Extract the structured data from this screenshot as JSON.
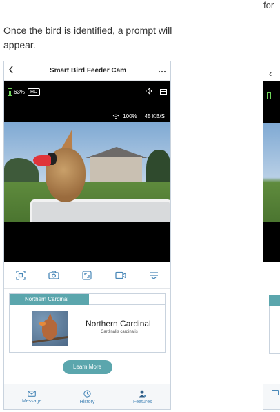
{
  "page": {
    "partial_text_right": "for",
    "instruction": "Once the bird is identified, a prompt will appear."
  },
  "app": {
    "title": "Smart Bird Feeder Cam",
    "back_icon": "chevron-left-icon",
    "more_icon": "more-dots-icon"
  },
  "status": {
    "battery": "63%",
    "quality": "HD",
    "wifi": "100%",
    "speed": "45 KB/S"
  },
  "controls": [
    {
      "name": "scan-icon"
    },
    {
      "name": "camera-icon"
    },
    {
      "name": "fullscreen-icon"
    },
    {
      "name": "video-record-icon"
    },
    {
      "name": "menu-icon"
    }
  ],
  "result": {
    "tab_label": "Northern Cardinal",
    "name": "Northern Cardinal",
    "scientific": "Cardinalis cardinalis"
  },
  "learn_more": "Learn More",
  "nav": {
    "message": "Message",
    "history": "History",
    "features": "Features"
  },
  "colors": {
    "accent": "#5ba6ad",
    "nav_blue": "#4a88b8",
    "battery_green": "#6fd35a"
  }
}
